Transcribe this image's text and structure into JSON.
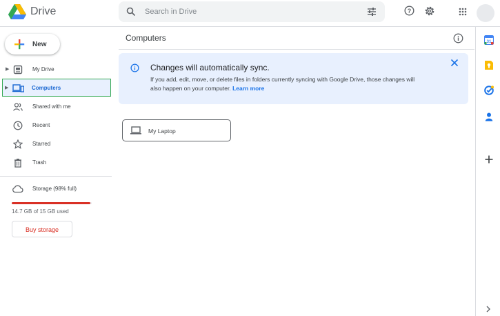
{
  "app": {
    "title": "Drive"
  },
  "search": {
    "placeholder": "Search in Drive"
  },
  "sidebar": {
    "new_label": "New",
    "items": [
      {
        "label": "My Drive"
      },
      {
        "label": "Computers"
      },
      {
        "label": "Shared with me"
      },
      {
        "label": "Recent"
      },
      {
        "label": "Starred"
      },
      {
        "label": "Trash"
      }
    ],
    "storage": {
      "label": "Storage (98% full)",
      "used_text": "14.7 GB of 15 GB used",
      "fill_fraction": 0.98,
      "buy_label": "Buy storage"
    }
  },
  "main": {
    "title": "Computers",
    "banner": {
      "title": "Changes will automatically sync.",
      "body": "If you add, edit, move, or delete files in folders currently syncing with Google Drive, those changes will also happen on your computer.",
      "link": "Learn more"
    },
    "computers": [
      {
        "label": "My Laptop"
      }
    ]
  },
  "colors": {
    "accent": "#1a73e8",
    "active_bg": "#e8f0fe",
    "storage_bar": "#d93025",
    "highlight_border": "#34a853"
  },
  "icons": [
    "drive-logo-icon",
    "search-icon",
    "tune-icon",
    "help-icon",
    "settings-icon",
    "apps-icon",
    "plus-icon",
    "my-drive-icon",
    "computer-icon",
    "people-icon",
    "clock-icon",
    "star-icon",
    "trash-icon",
    "cloud-icon",
    "info-icon",
    "close-icon",
    "laptop-icon",
    "calendar-icon",
    "keep-icon",
    "tasks-icon",
    "contacts-icon",
    "add-icon",
    "chevron-right-icon"
  ]
}
